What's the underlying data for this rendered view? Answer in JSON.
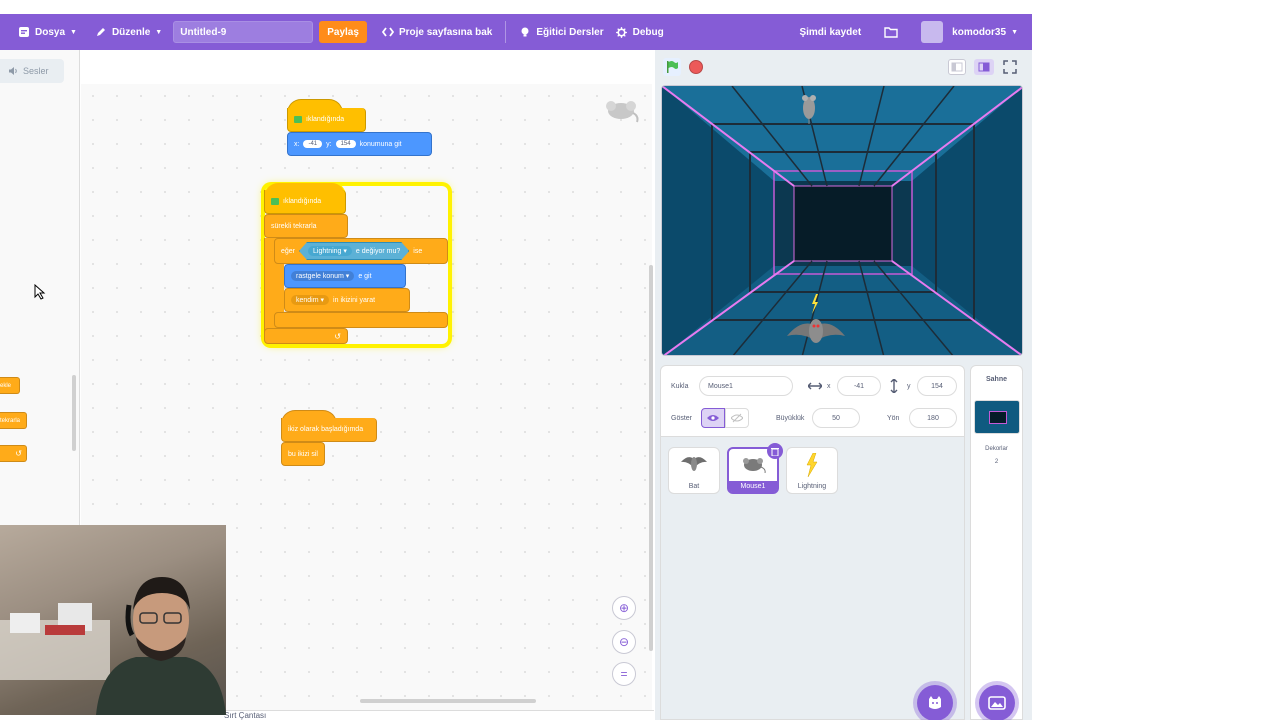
{
  "menu": {
    "file": "Dosya",
    "edit": "Düzenle",
    "project_title": "Untitled-9",
    "share": "Paylaş",
    "see_project_page": "Proje sayfasına bak",
    "tutorials": "Eğitici Dersler",
    "debug": "Debug",
    "save_now": "Şimdi kaydet",
    "username": "komodor35"
  },
  "left": {
    "sounds_tab": "Sesler",
    "palette_blocks": [
      "ekle",
      "tekrarla",
      ""
    ]
  },
  "scripts": {
    "script1": {
      "hat": "ıklandığında",
      "goto_label_x": "x:",
      "goto_x": "-41",
      "goto_label_y": "y:",
      "goto_y": "154",
      "goto_tail": "konumuna git"
    },
    "script2": {
      "hat": "ıklandığında",
      "forever": "sürekli tekrarla",
      "if_label": "eğer",
      "sensing_target": "Lightning",
      "sensing_tail": "e değiyor mu?",
      "then": "ise",
      "goto_random": "rastgele konum",
      "goto_tail": "e git",
      "clone_target": "kendim",
      "clone_tail": "in ikizini yarat"
    },
    "script3": {
      "hat": "ikiz olarak başladığımda",
      "delete_clone": "bu ikizi sil"
    }
  },
  "backpack": "Sırt Çantası",
  "sprite_info": {
    "sprite_label": "Kukla",
    "sprite_name": "Mouse1",
    "x_label": "x",
    "x_value": "-41",
    "y_label": "y",
    "y_value": "154",
    "show_label": "Göster",
    "size_label": "Büyüklük",
    "size_value": "50",
    "direction_label": "Yön",
    "direction_value": "180"
  },
  "sprites": [
    "Bat",
    "Mouse1",
    "Lightning"
  ],
  "stage_panel": {
    "title": "Sahne",
    "backdrops_label": "Dekorlar",
    "backdrops_count": "2"
  },
  "colors": {
    "menu_bar": "#855cd6",
    "share": "#ff8c1a",
    "events": "#ffbf00",
    "motion": "#4c97ff",
    "control": "#ffab19",
    "sensing": "#5cb1d6"
  }
}
